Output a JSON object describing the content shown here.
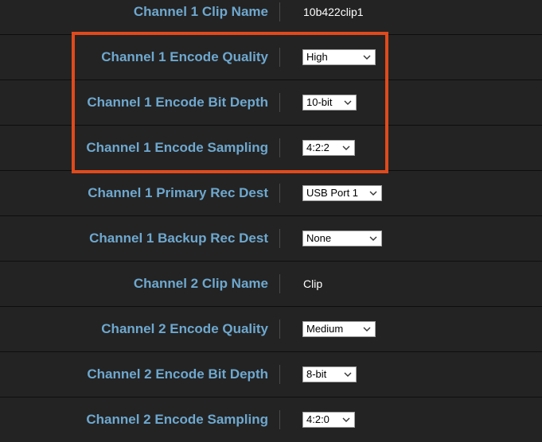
{
  "rows": [
    {
      "label": "Channel 1 Clip Name",
      "value": "10b422clip1",
      "type": "text"
    },
    {
      "label": "Channel 1 Encode Quality",
      "value": "High",
      "type": "select"
    },
    {
      "label": "Channel 1 Encode Bit Depth",
      "value": "10-bit",
      "type": "select"
    },
    {
      "label": "Channel 1 Encode Sampling",
      "value": "4:2:2",
      "type": "select"
    },
    {
      "label": "Channel 1 Primary Rec Dest",
      "value": "USB Port 1",
      "type": "select"
    },
    {
      "label": "Channel 1 Backup Rec Dest",
      "value": "None",
      "type": "select"
    },
    {
      "label": "Channel 2 Clip Name",
      "value": "Clip",
      "type": "text"
    },
    {
      "label": "Channel 2 Encode Quality",
      "value": "Medium",
      "type": "select"
    },
    {
      "label": "Channel 2 Encode Bit Depth",
      "value": "8-bit",
      "type": "select"
    },
    {
      "label": "Channel 2 Encode Sampling",
      "value": "4:2:0",
      "type": "select"
    }
  ],
  "colors": {
    "background": "#232323",
    "label": "#6ea8cf",
    "highlight": "#e04a1c"
  },
  "icons": {
    "dropdown": "chevron-down-icon"
  }
}
